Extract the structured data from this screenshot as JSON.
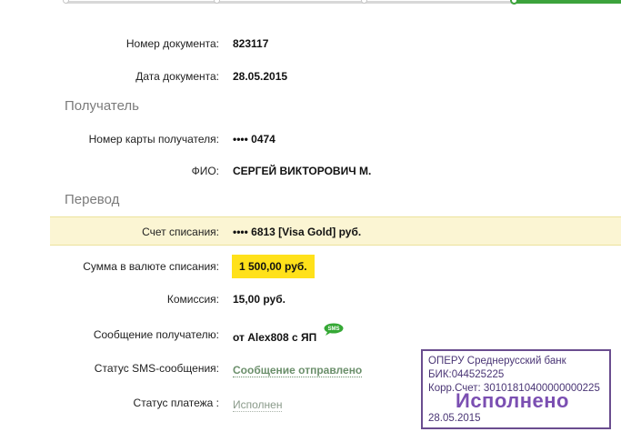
{
  "document": {
    "number_label": "Номер документа:",
    "number_value": "823117",
    "date_label": "Дата документа:",
    "date_value": "28.05.2015"
  },
  "recipient": {
    "section_title": "Получатель",
    "card_label": "Номер карты получателя:",
    "card_value": "•••• 0474",
    "name_label": "ФИО:",
    "name_value": "СЕРГЕЙ ВИКТОРОВИЧ М."
  },
  "transfer": {
    "section_title": "Перевод",
    "account_label": "Счет списания:",
    "account_value": "•••• 6813  [Visa Gold]  руб.",
    "amount_label": "Сумма в валюте списания:",
    "amount_value": "1 500,00  руб.",
    "fee_label": "Комиссия:",
    "fee_value": "15,00 руб.",
    "message_label": "Сообщение получателю:",
    "message_value": "от Alex808 с ЯП",
    "sms_icon_text": "SMS",
    "sms_status_label": "Статус SMS-сообщения:",
    "sms_status_value": "Сообщение отправлено",
    "payment_status_label": "Статус платежа :",
    "payment_status_value": "Исполнен"
  },
  "stamp": {
    "line1": "ОПЕРУ Среднерусский банк",
    "line2": "БИК:044525225",
    "line3": "Корр.Счет: 30101810400000000225",
    "status": "Исполнено",
    "date": "28.05.2015"
  },
  "colors": {
    "accent_green": "#3ca33c",
    "highlight_yellow": "#ffe11a",
    "row_highlight": "#fbf5d3",
    "stamp_purple": "#6a4d8f"
  }
}
